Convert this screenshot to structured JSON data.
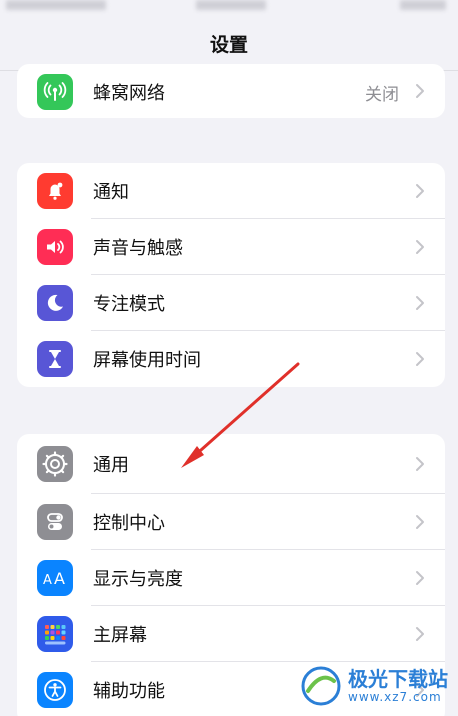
{
  "nav": {
    "title": "设置"
  },
  "group_top": {
    "items": [
      {
        "label": "蜂窝网络",
        "value": "关闭",
        "color": "#34c759"
      }
    ]
  },
  "group_notify": {
    "items": [
      {
        "label": "通知",
        "color": "#ff3b30"
      },
      {
        "label": "声音与触感",
        "color": "#ff2d55"
      },
      {
        "label": "专注模式",
        "color": "#5856d6"
      },
      {
        "label": "屏幕使用时间",
        "color": "#5856d6"
      }
    ]
  },
  "group_general": {
    "items": [
      {
        "label": "通用",
        "color": "#8e8e93"
      },
      {
        "label": "控制中心",
        "color": "#8e8e93"
      },
      {
        "label": "显示与亮度",
        "color": "#0a84ff"
      },
      {
        "label": "主屏幕",
        "color": "#2f5bea"
      },
      {
        "label": "辅助功能",
        "color": "#0a84ff"
      }
    ]
  },
  "watermark": {
    "name": "极光下载站",
    "url": "www.xz7.com"
  },
  "annotation": {
    "color": "#e0302a"
  }
}
